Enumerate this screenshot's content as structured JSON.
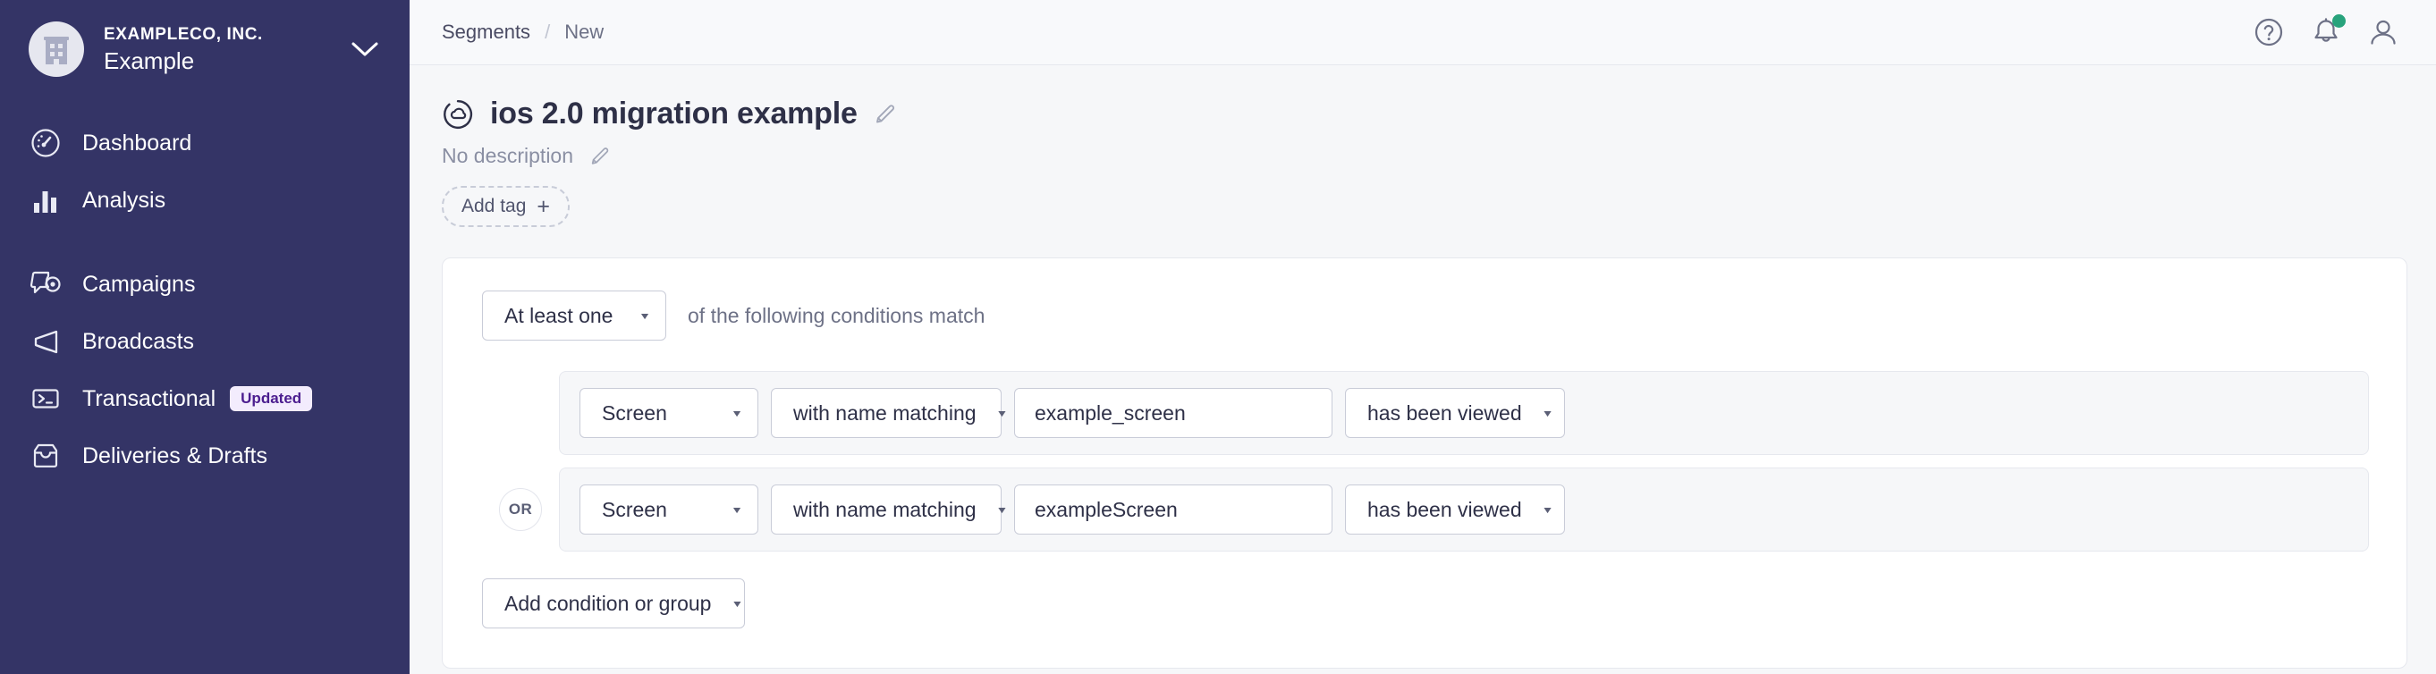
{
  "sidebar": {
    "org": {
      "name": "EXAMPLECO, INC.",
      "workspace": "Example",
      "avatar_icon": "building-icon",
      "caret_icon": "chevron-down-icon"
    },
    "groups": [
      {
        "items": [
          {
            "label": "Dashboard",
            "icon": "gauge-icon"
          },
          {
            "label": "Analysis",
            "icon": "bar-chart-icon"
          }
        ]
      },
      {
        "items": [
          {
            "label": "Campaigns",
            "icon": "speech-bubble-target-icon"
          },
          {
            "label": "Broadcasts",
            "icon": "megaphone-icon"
          },
          {
            "label": "Transactional",
            "icon": "terminal-icon",
            "badge": "Updated"
          },
          {
            "label": "Deliveries & Drafts",
            "icon": "inbox-icon"
          }
        ]
      }
    ]
  },
  "topbar": {
    "breadcrumb": {
      "parent": "Segments",
      "separator": "/",
      "current": "New"
    },
    "icons": {
      "help": "question-circle-icon",
      "notifications": "bell-icon",
      "account": "user-icon"
    },
    "notification_dot_color": "#28a37c"
  },
  "page": {
    "segment_icon": "segment-cloud-icon",
    "title": "ios 2.0 migration example",
    "title_edit_icon": "pencil-icon",
    "description": "No description",
    "description_edit_icon": "pencil-icon",
    "add_tag_label": "Add tag",
    "add_tag_plus": "+"
  },
  "builder": {
    "match_mode": "At least one",
    "match_text": "of the following conditions match",
    "caret_icon": "chevron-down-small-icon",
    "conditions": [
      {
        "joiner": "",
        "subject": "Screen",
        "operator": "with name matching",
        "value": "example_screen",
        "action": "has been viewed"
      },
      {
        "joiner": "OR",
        "subject": "Screen",
        "operator": "with name matching",
        "value": "exampleScreen",
        "action": "has been viewed"
      }
    ],
    "add_condition_label": "Add condition or group"
  },
  "colors": {
    "sidebar_bg": "#343466",
    "page_bg": "#f6f7f9",
    "card_bg": "#ffffff",
    "badge_bg": "#f3ecfd",
    "badge_text": "#4b1d8f",
    "accent_green": "#28a37c",
    "text_primary": "#2e3047",
    "text_muted": "#6d7186"
  }
}
